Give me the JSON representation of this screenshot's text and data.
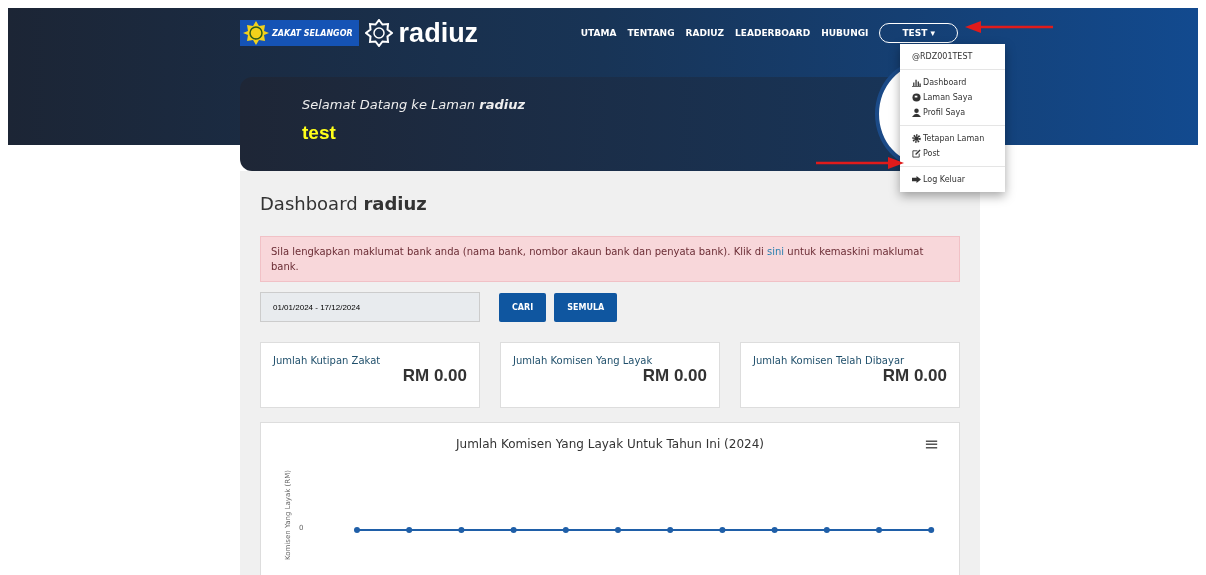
{
  "brand": {
    "org": "ZAKAT SELANGOR",
    "name": "radiuz"
  },
  "nav": [
    {
      "label": "UTAMA"
    },
    {
      "label": "TENTANG"
    },
    {
      "label": "RADIUZ"
    },
    {
      "label": "LEADERBOARD"
    },
    {
      "label": "HUBUNGI"
    }
  ],
  "user_button": {
    "label": "TEST",
    "caret": "▾",
    "expanded": true
  },
  "user_menu": {
    "username": "@RDZ001TEST",
    "groups": [
      [
        {
          "kind": "chart",
          "label": "Dashboard"
        },
        {
          "kind": "globe",
          "label": "Laman Saya"
        },
        {
          "kind": "user",
          "label": "Profil Saya"
        }
      ],
      [
        {
          "kind": "gear",
          "label": "Tetapan Laman"
        },
        {
          "kind": "edit",
          "label": "Post"
        }
      ],
      [
        {
          "kind": "exit",
          "label": "Log Keluar"
        }
      ]
    ]
  },
  "welcome": {
    "greeting": "Selamat Datang ke Laman **radiuz**",
    "user": "test"
  },
  "dashboard": {
    "title": "Dashboard **radiuz**",
    "alert": {
      "before": "Sila lengkapkan maklumat bank anda (nama bank, nombor akaun bank dan penyata bank). Klik di ",
      "link": "sini",
      "after": " untuk kemaskini maklumat bank."
    },
    "date_range": "01/01/2024 - 17/12/2024",
    "buttons": [
      "CARI",
      "SEMULA"
    ],
    "cards": [
      {
        "label": "Jumlah Kutipan Zakat",
        "value": "RM 0.00"
      },
      {
        "label": "Jumlah Komisen Yang Layak",
        "value": "RM 0.00"
      },
      {
        "label": "Jumlah Komisen Telah Dibayar",
        "value": "RM 0.00"
      }
    ],
    "chart": {
      "title": "Jumlah Komisen Yang Layak Untuk Tahun Ini (2024)",
      "ylabel": "Komisen Yang Layak (RM)",
      "ytick": "0",
      "menu": "≡"
    }
  }
}
